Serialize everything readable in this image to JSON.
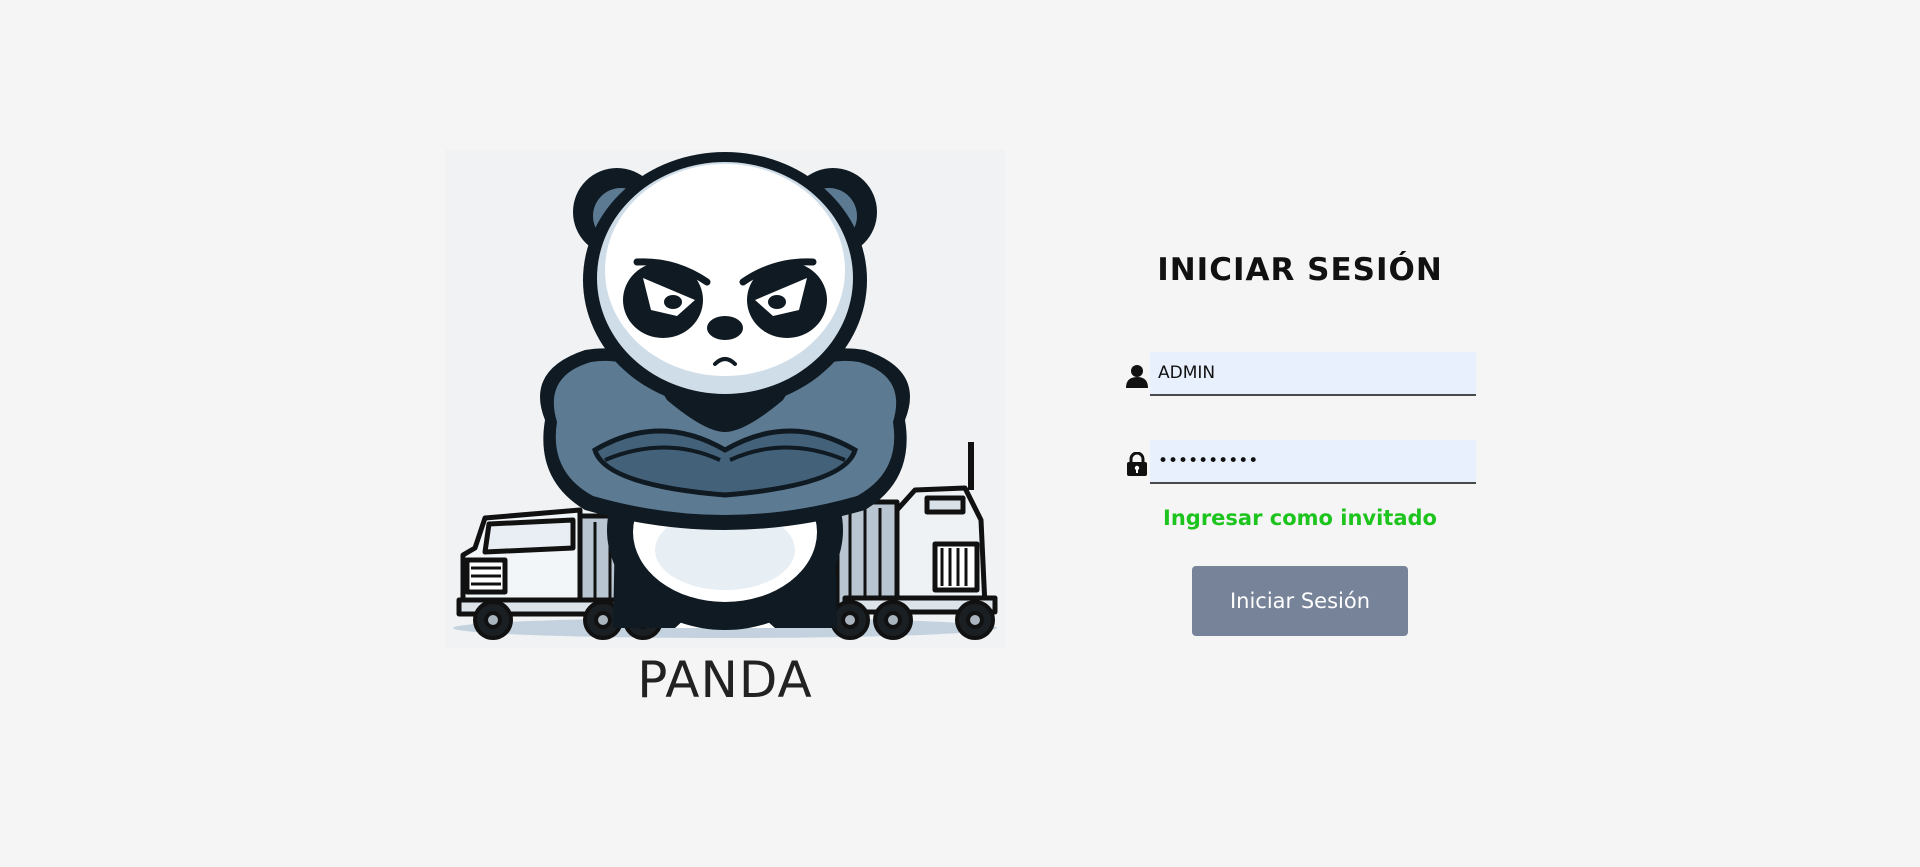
{
  "brand": {
    "name": "PANDA",
    "logo_icon": "angry-panda-trucks-logo"
  },
  "login": {
    "title": "INICIAR SESIÓN",
    "username": {
      "icon": "user-icon",
      "value": "ADMIN"
    },
    "password": {
      "icon": "lock-icon",
      "value": "••••••••••"
    },
    "guest_link": "Ingresar como invitado",
    "submit_label": "Iniciar Sesión"
  },
  "colors": {
    "background": "#f5f5f5",
    "input_fill": "#e8f0fe",
    "guest_link": "#1ec41e",
    "button": "#778399",
    "panda_blue": "#5d7a93",
    "panda_dark": "#0f1a22"
  }
}
